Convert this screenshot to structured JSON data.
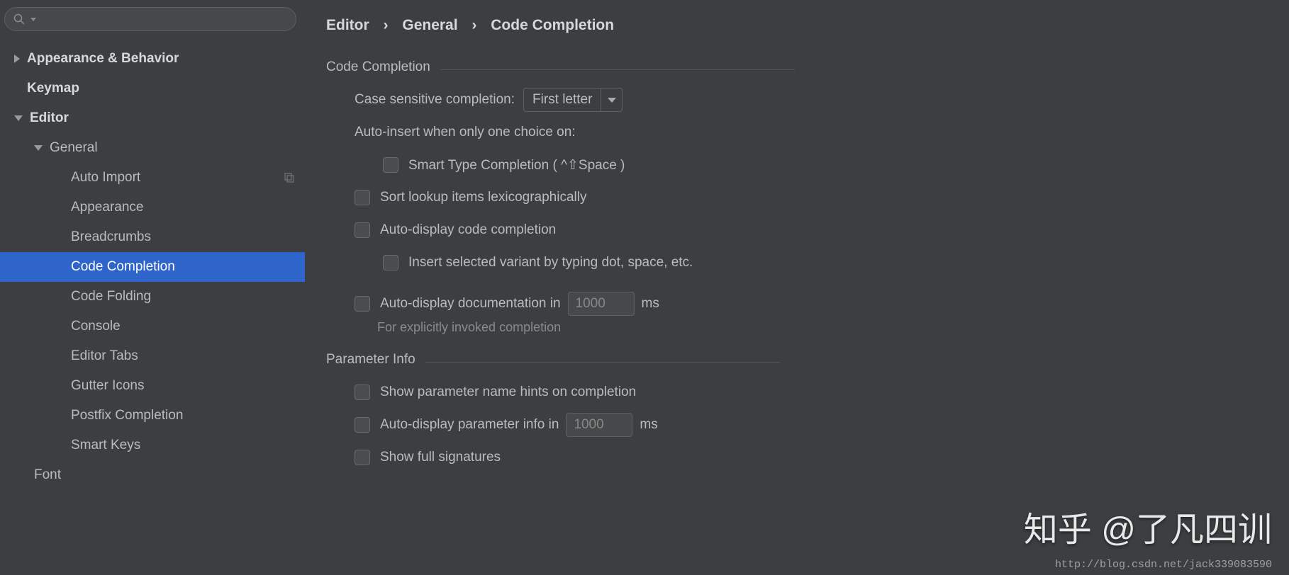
{
  "search": {
    "placeholder": ""
  },
  "sidebar": {
    "items": [
      {
        "label": "Appearance & Behavior"
      },
      {
        "label": "Keymap"
      },
      {
        "label": "Editor"
      },
      {
        "label": "General"
      },
      {
        "label": "Auto Import"
      },
      {
        "label": "Appearance"
      },
      {
        "label": "Breadcrumbs"
      },
      {
        "label": "Code Completion"
      },
      {
        "label": "Code Folding"
      },
      {
        "label": "Console"
      },
      {
        "label": "Editor Tabs"
      },
      {
        "label": "Gutter Icons"
      },
      {
        "label": "Postfix Completion"
      },
      {
        "label": "Smart Keys"
      },
      {
        "label": "Font"
      }
    ]
  },
  "breadcrumb": {
    "a": "Editor",
    "b": "General",
    "c": "Code Completion"
  },
  "section1": {
    "title": "Code Completion",
    "case_label": "Case sensitive completion:",
    "case_value": "First letter",
    "auto_insert_label": "Auto-insert when only one choice on:",
    "smart_type": "Smart Type Completion ( ^⇧Space )",
    "sort_lexi": "Sort lookup items lexicographically",
    "auto_display": "Auto-display code completion",
    "insert_variant": "Insert selected variant by typing dot, space, etc.",
    "auto_doc_label": "Auto-display documentation in",
    "auto_doc_value": "1000",
    "ms": "ms",
    "auto_doc_hint": "For explicitly invoked completion"
  },
  "section2": {
    "title": "Parameter Info",
    "hints": "Show parameter name hints on completion",
    "auto_param_label": "Auto-display parameter info in",
    "auto_param_value": "1000",
    "ms": "ms",
    "full_sig": "Show full signatures"
  },
  "watermark1": "知乎 @了凡四训",
  "watermark2": "http://blog.csdn.net/jack339083590"
}
